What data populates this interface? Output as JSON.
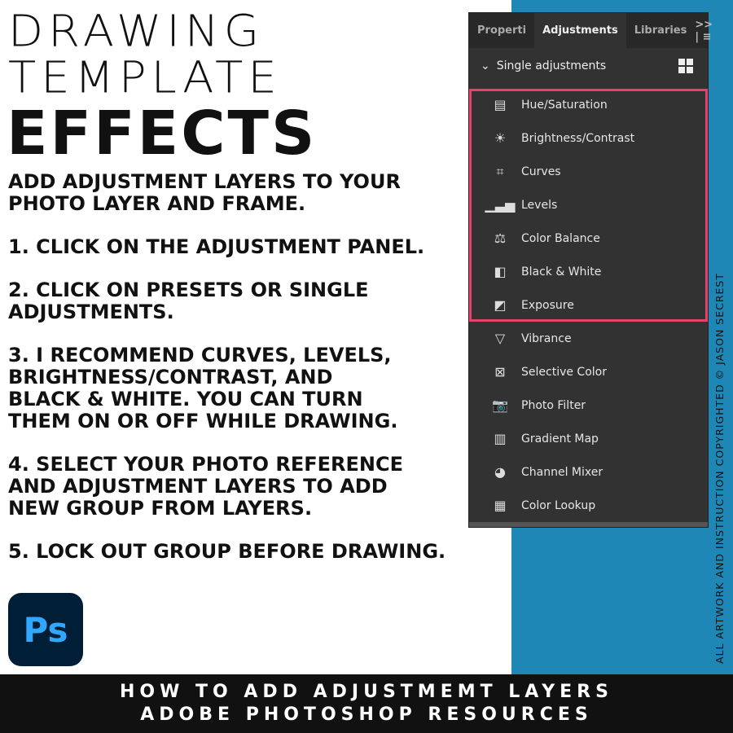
{
  "title": {
    "line1": "DRAWING",
    "line2": "TEMPLATE",
    "line3": "EFFECTS"
  },
  "instructions": [
    "ADD ADJUSTMENT LAYERS TO YOUR\nPHOTO LAYER AND FRAME.",
    "1. CLICK ON THE ADJUSTMENT PANEL.",
    "2. CLICK ON PRESETS OR SINGLE\nADJUSTMENTS.",
    "3. I RECOMMEND CURVES, LEVELS,\nBRIGHTNESS/CONTRAST, AND\nBLACK & WHITE. YOU CAN TURN\nTHEM ON OR OFF WHILE DRAWING.",
    "4. SELECT YOUR PHOTO REFERENCE\nAND ADJUSTMENT LAYERS TO ADD\nNEW GROUP FROM LAYERS.",
    "5. LOCK OUT GROUP BEFORE DRAWING."
  ],
  "logo": {
    "text": "Ps"
  },
  "footer": {
    "line1": "HOW TO ADD ADJUSTMEMT LAYERS",
    "line2": "ADOBE PHOTOSHOP RESOURCES"
  },
  "copyright": "ALL ARTWORK AND INSTRUCTION COPYRIGHTED © JASON SECREST",
  "panel": {
    "tabs": [
      "Properti",
      "Adjustments",
      "Libraries"
    ],
    "more": ">> | ≡",
    "section": "Single adjustments",
    "items": [
      {
        "label": "Hue/Saturation",
        "icon": "▤"
      },
      {
        "label": "Brightness/Contrast",
        "icon": "☀"
      },
      {
        "label": "Curves",
        "icon": "⌗"
      },
      {
        "label": "Levels",
        "icon": "▁▃▅"
      },
      {
        "label": "Color Balance",
        "icon": "⚖"
      },
      {
        "label": "Black & White",
        "icon": "◧"
      },
      {
        "label": "Exposure",
        "icon": "◩"
      },
      {
        "label": "Vibrance",
        "icon": "▽"
      },
      {
        "label": "Selective Color",
        "icon": "⊠"
      },
      {
        "label": "Photo Filter",
        "icon": "📷"
      },
      {
        "label": "Gradient Map",
        "icon": "▥"
      },
      {
        "label": "Channel Mixer",
        "icon": "◕"
      },
      {
        "label": "Color Lookup",
        "icon": "▦"
      }
    ]
  },
  "colors": {
    "blue": "#1f87b5",
    "highlight": "#e8416c",
    "panel": "#323232"
  }
}
